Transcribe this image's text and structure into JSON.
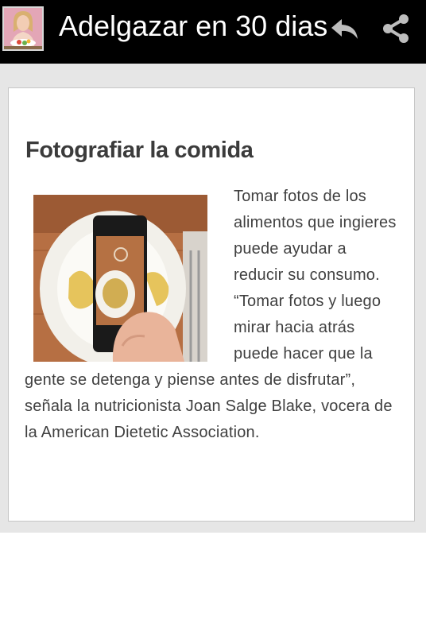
{
  "app_bar": {
    "title": "Adelgazar en 30 dias",
    "app_icon": "woman-eating-salad-thumbnail",
    "actions": [
      {
        "icon": "reply-icon"
      },
      {
        "icon": "share-icon"
      }
    ],
    "background": "#000000"
  },
  "article": {
    "title": "Fotografiar la comida",
    "image": "photo-of-plate-of-pasta-on-smartphone",
    "body": "Tomar fotos de los alimentos que ingieres puede ayudar a reducir su consumo. “Tomar fotos y luego mirar hacia atrás puede hacer que la gente se detenga y piense antes de disfrutar”, señala la nutricionista Joan Salge Blake, vocera de la American Dietetic Association."
  },
  "colors": {
    "page_background": "#e6e6e6",
    "card_background": "#ffffff",
    "text": "#404040"
  }
}
